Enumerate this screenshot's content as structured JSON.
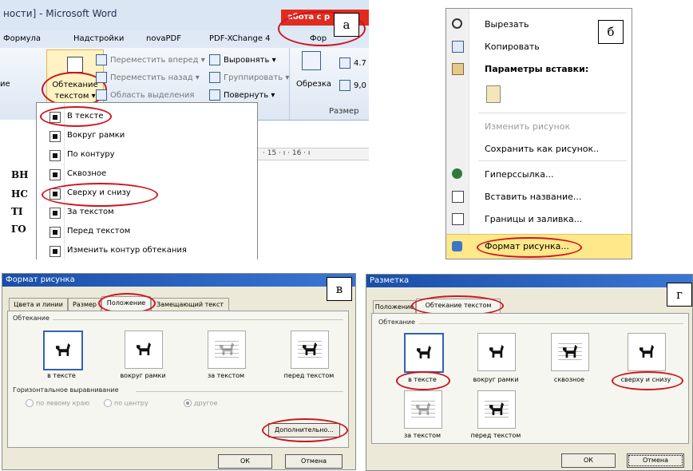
{
  "panel_a": {
    "letter": "а",
    "title": "ности] - Microsoft Word",
    "context_tab": "абота с р",
    "context_subtab": "Фор",
    "tabs": [
      "Формула",
      "Надстройки",
      "novaPDF",
      "PDF-XChange 4"
    ],
    "ribbon": {
      "wrap_button_line1": "Обтекание",
      "wrap_button_line2": "текстом ▾",
      "left_label": "ие",
      "bring_forward": "Переместить вперед ▾",
      "send_backward": "Переместить назад ▾",
      "selection_pane": "Область выделения",
      "align": "Выровнять ▾",
      "group": "Группировать ▾",
      "rotate": "Повернуть ▾",
      "crop": "Обрезка",
      "size_h": "4.7",
      "size_w": "9,0",
      "size_group": "Размер"
    },
    "menu_items": [
      "В тексте",
      "Вокруг рамки",
      "По контуру",
      "Сквозное",
      "Сверху и снизу",
      "За текстом",
      "Перед текстом",
      "Изменить контур обтекания"
    ],
    "doc_fragments": [
      "ВН",
      "НС",
      "ТІ",
      "ГО"
    ],
    "ruler": "· 15 · ı · 16 · ı"
  },
  "panel_b": {
    "letter": "б",
    "items": [
      {
        "label": "Вырезать",
        "bold": false,
        "disabled": false,
        "icon": "scissors-icon"
      },
      {
        "label": "Копировать",
        "bold": false,
        "disabled": false,
        "icon": "copy-icon"
      },
      {
        "label": "Параметры вставки:",
        "bold": true,
        "disabled": false,
        "icon": "paste-icon"
      },
      {
        "label": "",
        "bold": false,
        "disabled": false,
        "icon": "paste-option-icon"
      },
      {
        "label": "Изменить рисунок",
        "bold": false,
        "disabled": true,
        "icon": ""
      },
      {
        "label": "Сохранить как рисунок..",
        "bold": false,
        "disabled": false,
        "icon": ""
      },
      {
        "label": "Гиперссылка...",
        "bold": false,
        "disabled": false,
        "icon": "hyperlink-icon"
      },
      {
        "label": "Вставить название...",
        "bold": false,
        "disabled": false,
        "icon": "caption-icon"
      },
      {
        "label": "Границы и заливка...",
        "bold": false,
        "disabled": false,
        "icon": "borders-icon"
      },
      {
        "label": "Формат рисунка...",
        "bold": false,
        "disabled": false,
        "icon": "format-picture-icon"
      }
    ]
  },
  "panel_c": {
    "letter": "в",
    "title": "Формат рисунка",
    "tabs": [
      "Цвета и линии",
      "Размер",
      "Положение",
      "Замещающий текст"
    ],
    "wrap_group": "Обтекание",
    "wrap_options": [
      "в тексте",
      "вокруг рамки",
      "за текстом",
      "перед текстом"
    ],
    "halign_group": "Горизонтальное выравнивание",
    "halign_options": [
      "по левому краю",
      "по центру",
      "другое"
    ],
    "advanced_button": "Дополнительно...",
    "ok": "ОК",
    "cancel": "Отмена"
  },
  "panel_d": {
    "letter": "г",
    "title": "Разметка",
    "tabs": [
      "Положение",
      "Обтекание текстом"
    ],
    "wrap_group": "Обтекание",
    "wrap_options": [
      "в тексте",
      "вокруг рамки",
      "сквозное",
      "сверху и снизу",
      "за текстом",
      "перед текстом"
    ],
    "ok": "ОК",
    "cancel": "Отмена"
  },
  "colors": {
    "highlight_red": "#d0141e",
    "menu_hover": "#ffe88a",
    "ribbon_blue": "#dde7f3",
    "dialog_bg": "#ece9d8"
  }
}
